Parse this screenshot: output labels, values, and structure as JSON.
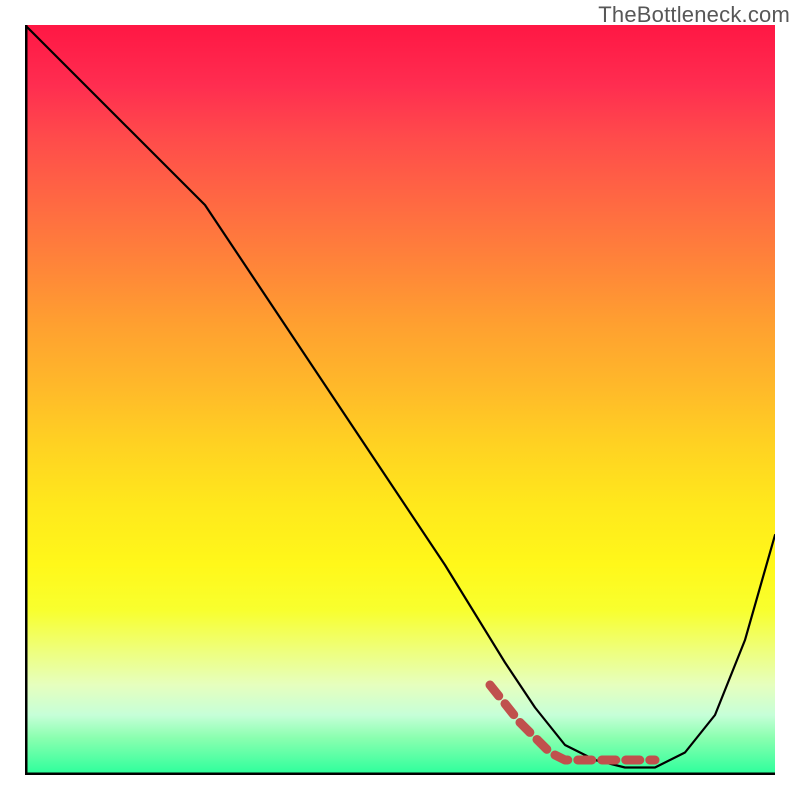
{
  "watermark": "TheBottleneck.com",
  "chart_data": {
    "type": "line",
    "title": "",
    "xlabel": "",
    "ylabel": "",
    "xlim": [
      0,
      100
    ],
    "ylim": [
      0,
      100
    ],
    "grid": false,
    "legend": false,
    "description": "Bottleneck curve over a vertical rainbow gradient (red=high bottleneck at top, green=low at bottom). Black curve shows bottleneck percentage vs x; red dashed segment marks the optimal low-bottleneck region.",
    "series": [
      {
        "name": "bottleneck-curve",
        "color": "#000000",
        "style": "solid",
        "x": [
          0,
          8,
          18,
          24,
          40,
          56,
          64,
          68,
          72,
          76,
          80,
          84,
          88,
          92,
          96,
          100
        ],
        "values": [
          100,
          92,
          82,
          76,
          52,
          28,
          15,
          9,
          4,
          2,
          1,
          1,
          3,
          8,
          18,
          32
        ]
      },
      {
        "name": "optimal-region",
        "color": "#c0504d",
        "style": "dashed-thick",
        "x": [
          62,
          66,
          70,
          72,
          76,
          80,
          84
        ],
        "values": [
          12,
          7,
          3,
          2,
          2,
          2,
          2
        ]
      }
    ],
    "gradient_stops": [
      {
        "pos": 0,
        "color": "#ff1744",
        "meaning": "high bottleneck"
      },
      {
        "pos": 50,
        "color": "#ffe81c",
        "meaning": "medium"
      },
      {
        "pos": 100,
        "color": "#2aff9b",
        "meaning": "low bottleneck"
      }
    ]
  }
}
